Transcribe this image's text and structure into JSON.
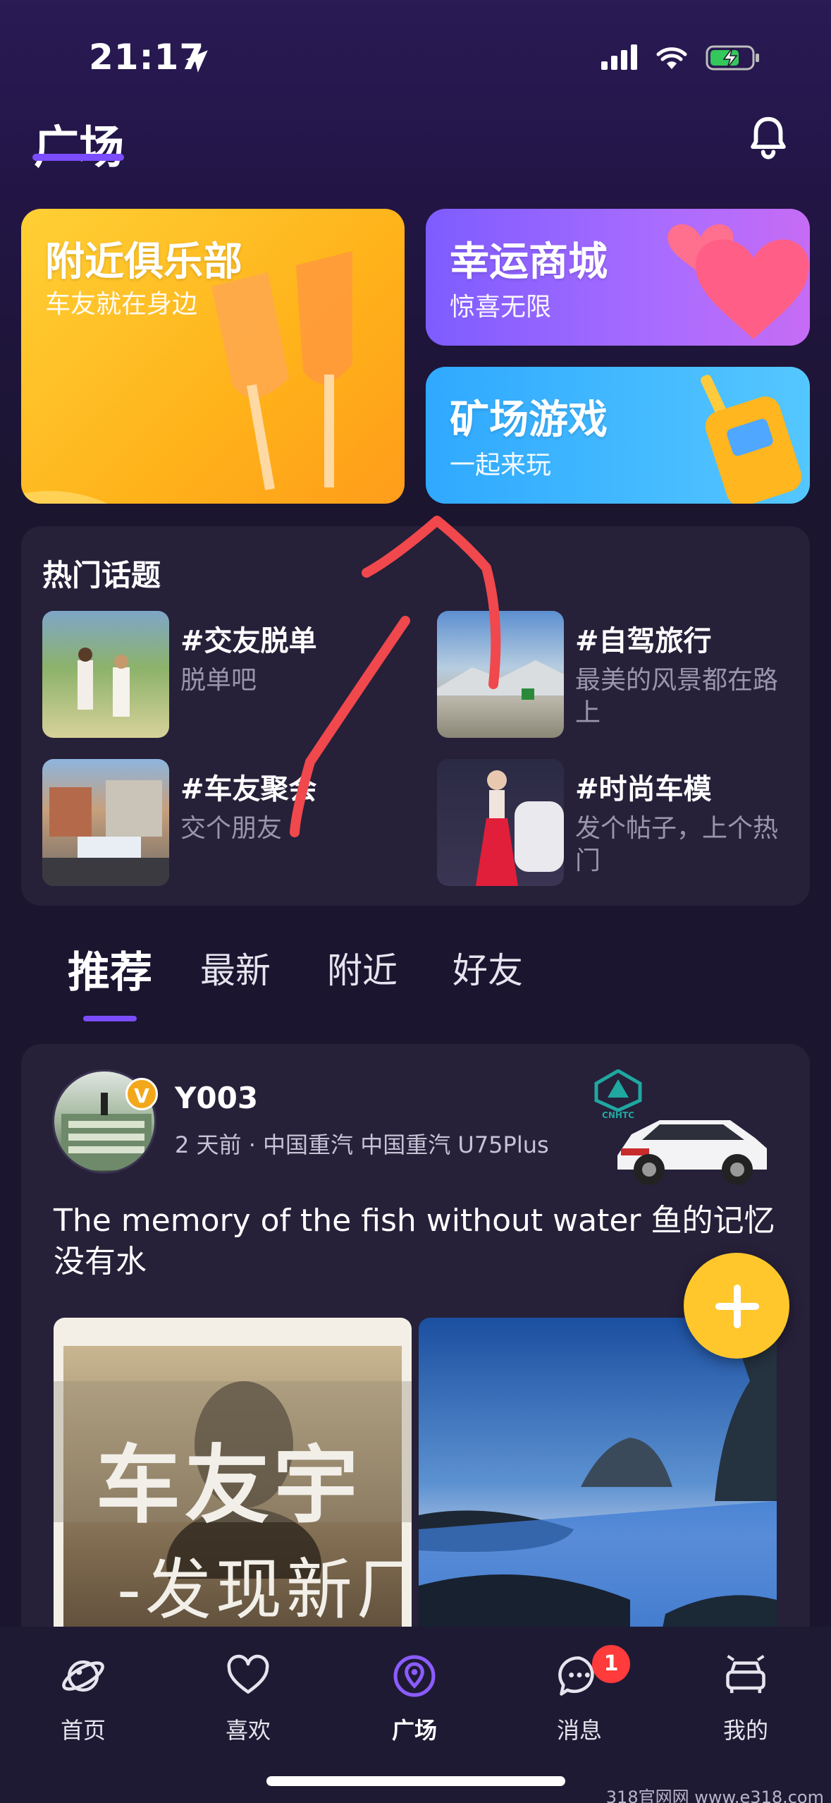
{
  "status_bar": {
    "time": "21:17"
  },
  "header": {
    "title": "广场"
  },
  "feature_cards": {
    "club": {
      "title": "附近俱乐部",
      "subtitle": "车友就在身边"
    },
    "mall": {
      "title": "幸运商城",
      "subtitle": "惊喜无限"
    },
    "game": {
      "title": "矿场游戏",
      "subtitle": "一起来玩"
    }
  },
  "hot_topics": {
    "title": "热门话题",
    "items": [
      {
        "name": "#交友脱单",
        "desc": "脱单吧"
      },
      {
        "name": "#自驾旅行",
        "desc": "最美的风景都在路上"
      },
      {
        "name": "#车友聚会",
        "desc": "交个朋友"
      },
      {
        "name": "#时尚车模",
        "desc": "发个帖子，上个热门"
      }
    ]
  },
  "tabs": [
    {
      "label": "推荐",
      "active": true
    },
    {
      "label": "最新",
      "active": false
    },
    {
      "label": "附近",
      "active": false
    },
    {
      "label": "好友",
      "active": false
    }
  ],
  "post": {
    "username": "Y003",
    "meta": "2 天前 · 中国重汽  中国重汽 U75Plus",
    "verified_badge": "V",
    "brand_badge": "CNHTC",
    "text": "The memory of the fish without water 鱼的记忆没有水",
    "image1_text_line1": "车友宇",
    "image1_text_line2": "-发现新厂"
  },
  "bottom_nav": {
    "items": [
      {
        "label": "首页",
        "icon": "planet-icon",
        "active": false
      },
      {
        "label": "喜欢",
        "icon": "heart-icon",
        "active": false
      },
      {
        "label": "广场",
        "icon": "location-icon",
        "active": true
      },
      {
        "label": "消息",
        "icon": "chat-icon",
        "active": false,
        "badge": "1"
      },
      {
        "label": "我的",
        "icon": "car-icon",
        "active": false
      }
    ]
  },
  "watermark": "318官网网 www.e318.com",
  "colors": {
    "accent": "#7b4dff",
    "background": "#1b1530",
    "card_bg": "#262039",
    "fab": "#ffc72c",
    "badge": "#ff3b3b",
    "annotation": "#f0484c"
  }
}
